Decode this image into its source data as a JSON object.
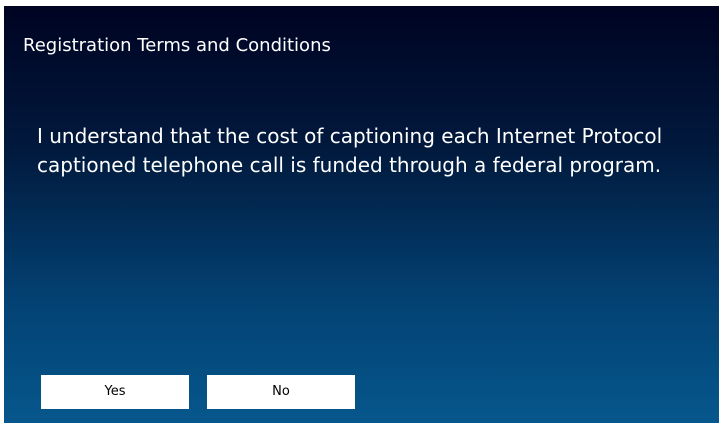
{
  "dialog": {
    "title": "Registration Terms and Conditions",
    "message": "I understand that the cost of captioning each Internet Protocol captioned telephone call is funded through a federal program.",
    "buttons": {
      "yes_label": "Yes",
      "no_label": "No"
    }
  },
  "colors": {
    "background_top": "#000322",
    "background_bottom": "#06578d",
    "text": "#ffffff",
    "button_background": "#ffffff",
    "button_text": "#000000"
  }
}
